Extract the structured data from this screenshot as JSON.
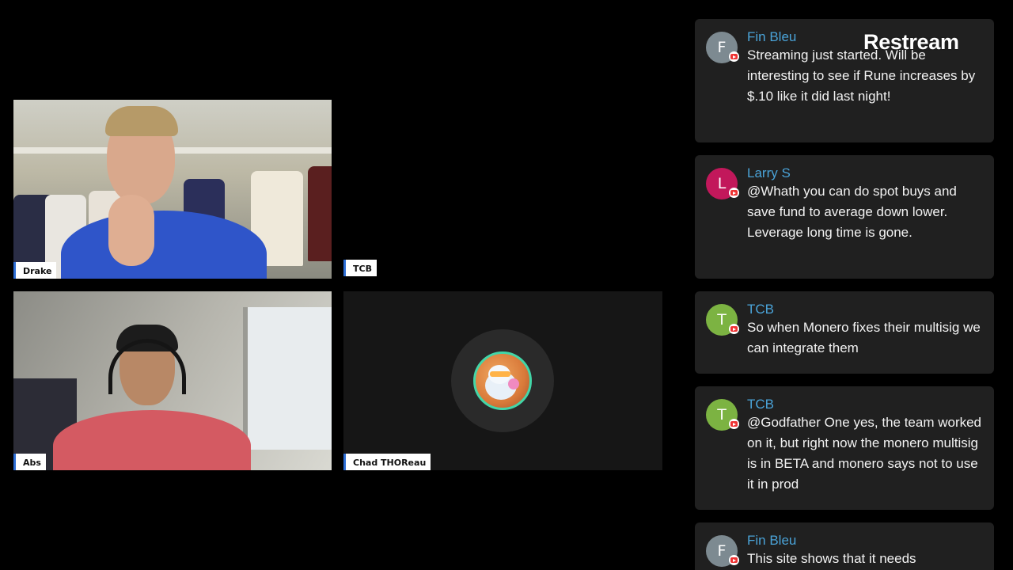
{
  "brand": "Restream",
  "participants": {
    "drake": {
      "label": "Drake"
    },
    "tcb": {
      "label": "TCB"
    },
    "abs": {
      "label": "Abs"
    },
    "chad": {
      "label": "Chad THOReau"
    }
  },
  "chat": {
    "messages": [
      {
        "initial": "F",
        "author": "Fin Bleu",
        "avatar_color": "#7d8a91",
        "text": "Streaming just started. Will be interesting to see if Rune increases by $.10 like it did last night!"
      },
      {
        "initial": "L",
        "author": "Larry S",
        "avatar_color": "#c2185b",
        "text": "@Whath you can do spot buys and save fund to average down lower. Leverage long time is gone."
      },
      {
        "initial": "T",
        "author": "TCB",
        "avatar_color": "#7cb342",
        "text": "So when Monero fixes their multisig we can integrate them"
      },
      {
        "initial": "T",
        "author": "TCB",
        "avatar_color": "#7cb342",
        "text": "@Godfather One yes, the team worked on it, but right now the monero multisig is in BETA and monero says not to use it in prod"
      },
      {
        "initial": "F",
        "author": "Fin Bleu",
        "avatar_color": "#7d8a91",
        "text": "This site shows that it needs"
      }
    ],
    "platform_icon": "youtube-icon"
  },
  "colors": {
    "author": "#4aa3d8",
    "card_bg": "#202020",
    "label_accent": "#2f6fd6"
  }
}
